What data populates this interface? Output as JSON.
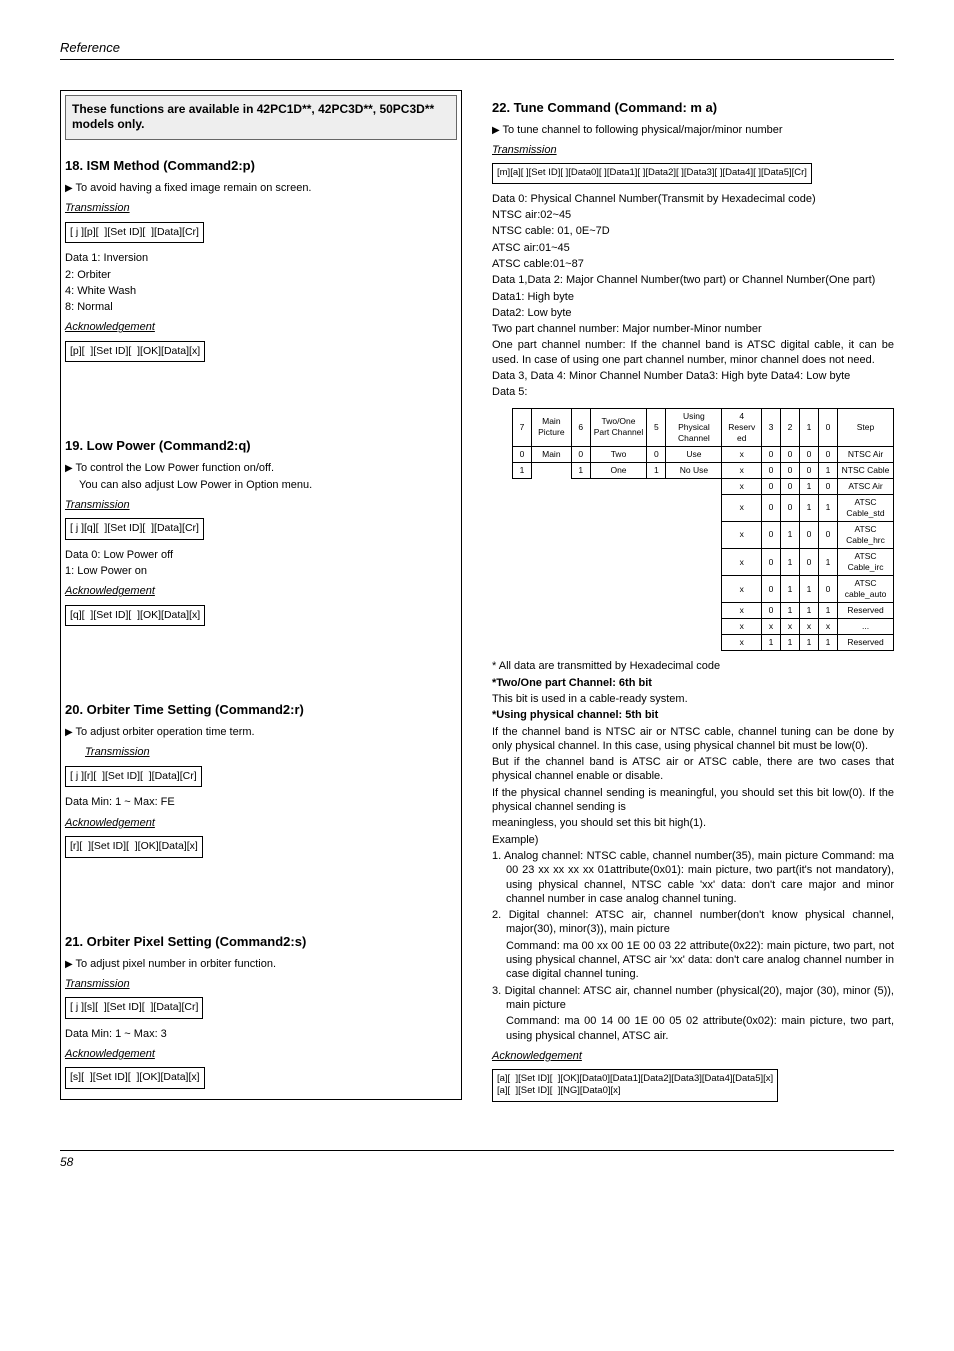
{
  "page": {
    "header": "Reference",
    "footer": "58"
  },
  "left": {
    "callout": "These functions are available in 42PC1D**, 42PC3D**,  50PC3D** models only.",
    "s18": {
      "title": "18. ISM Method (Command2:p)",
      "desc": "To avoid having a fixed image remain on screen.",
      "trans_h": "Transmission",
      "trans_box": "[ j ][p][  ][Set ID][  ][Data][Cr]",
      "data_h": "Data  1: Inversion",
      "d2": "2: Orbiter",
      "d3": "4: White Wash",
      "d4": "8: Normal",
      "ack_h": "Acknowledgement",
      "ack_box": "[p][  ][Set ID][  ][OK][Data][x]"
    },
    "s19": {
      "title": "19. Low Power (Command2:q)",
      "desc1": "To control the Low Power function on/off.",
      "desc2": "You can also adjust Low Power in Option menu.",
      "trans_h": "Transmission",
      "trans_box": "[ j ][q][  ][Set ID][  ][Data][Cr]",
      "data1": "Data  0: Low Power off",
      "data2": "1: Low Power on",
      "ack_h": "Acknowledgement",
      "ack_box": "[q][  ][Set ID][  ][OK][Data][x]"
    },
    "s20": {
      "title": "20. Orbiter Time Setting (Command2:r)",
      "desc": "To adjust orbiter operation time term.",
      "trans_h": "Transmission",
      "trans_box": "[ j ][r][  ][Set ID][  ][Data][Cr]",
      "data": "Data   Min: 1 ~ Max: FE",
      "ack_h": "Acknowledgement",
      "ack_box": "[r][  ][Set ID][  ][OK][Data][x]"
    },
    "s21": {
      "title": "21. Orbiter Pixel Setting (Command2:s)",
      "desc": "To adjust pixel number in orbiter function.",
      "trans_h": "Transmission",
      "trans_box": "[ j ][s][  ][Set ID][  ][Data][Cr]",
      "data": "Data   Min: 1 ~ Max: 3",
      "ack_h": "Acknowledgement",
      "ack_box": "[s][  ][Set ID][  ][OK][Data][x]"
    }
  },
  "right": {
    "s22": {
      "title": "22. Tune Command (Command: m a)",
      "desc": "To tune channel to following physical/major/minor number",
      "trans_h": "Transmission",
      "trans_box": "[m][a][ ][Set ID][ ][Data0][ ][Data1][ ][Data2][ ][Data3][ ][Data4][ ][Data5][Cr]",
      "data0": "Data  0: Physical Channel Number(Transmit by Hexadecimal code)",
      "d0_1": "NTSC air:02~45",
      "d0_2": "NTSC cable: 01, 0E~7D",
      "d0_3": "ATSC air:01~45",
      "d0_4": "ATSC cable:01~87",
      "data12": "Data 1,Data 2: Major Channel Number(two part) or Channel Number(One part)",
      "d12_1": "Data1: High byte",
      "d12_2": "Data2: Low byte",
      "d12_3": "Two part channel number: Major number-Minor number",
      "d12_4": "One part channel number: If the channel band is ATSC digital cable, it can be used. In case of using one part channel number, minor channel does not need.",
      "data34": "Data 3, Data 4: Minor Channel Number Data3: High byte Data4: Low byte",
      "data5": "Data 5:",
      "note_all": "* All data are transmitted by Hexadecimal code",
      "note_two_h": "*Two/One part Channel: 6th bit",
      "note_two": "This bit is used in a cable-ready system.",
      "note_phys_h": "*Using physical channel: 5th bit",
      "note_phys1": "If the channel band is NTSC air or NTSC cable, channel tuning can be done by only physical channel. In this case, using physical channel bit must be low(0).",
      "note_phys2": "But if the channel band is ATSC air or ATSC cable, there are two cases that physical channel enable or disable.",
      "note_phys3": "If the physical channel sending is meaningful, you should set this bit low(0). If the physical channel sending is",
      "note_phys4": "meaningless, you should set this bit high(1).",
      "example_h": "Example)",
      "ex1": "1. Analog channel: NTSC cable, channel number(35), main picture Command: ma 00 23 xx xx xx xx 01attribute(0x01): main picture, two part(it's not mandatory), using physical channel, NTSC cable 'xx' data: don't care major and minor channel number in case analog channel tuning.",
      "ex2": "2. Digital channel: ATSC air, channel number(don't know physical channel, major(30), minor(3)), main picture",
      "ex2b": "Command: ma 00 xx 00 1E 00 03 22 attribute(0x22): main picture, two part, not using physical channel, ATSC air 'xx' data: don't care analog channel number in case digital channel tuning.",
      "ex3": "3. Digital channel: ATSC air, channel number (physical(20), major (30), minor (5)), main picture",
      "ex3b": "Command: ma 00 14 00 1E 00 05 02 attribute(0x02): main picture, two part, using physical channel, ATSC air.",
      "ack_h": "Acknowledgement",
      "ack_box": "[a][  ][Set ID][  ][OK][Data0][Data1][Data2][Data3][Data4][Data5][x]\n[a][  ][Set ID][  ][NG][Data0][x]"
    },
    "table": {
      "rows": [
        [
          "7",
          "Main Picture",
          "6",
          "Two/One Part Channel",
          "5",
          "Using Physical Channel",
          "4 Reserv ed",
          "3",
          "2",
          "1",
          "0",
          "Step"
        ],
        [
          "0",
          "Main",
          "0",
          "Two",
          "0",
          "Use",
          "x",
          "0",
          "0",
          "0",
          "0",
          "NTSC Air"
        ],
        [
          "1",
          "",
          "1",
          "One",
          "1",
          "No Use",
          "x",
          "0",
          "0",
          "0",
          "1",
          "NTSC Cable"
        ],
        [
          "",
          "",
          "",
          "",
          "",
          "",
          "x",
          "0",
          "0",
          "1",
          "0",
          "ATSC Air"
        ],
        [
          "",
          "",
          "",
          "",
          "",
          "",
          "x",
          "0",
          "0",
          "1",
          "1",
          "ATSC Cable_std"
        ],
        [
          "",
          "",
          "",
          "",
          "",
          "",
          "x",
          "0",
          "1",
          "0",
          "0",
          "ATSC Cable_hrc"
        ],
        [
          "",
          "",
          "",
          "",
          "",
          "",
          "x",
          "0",
          "1",
          "0",
          "1",
          "ATSC Cable_irc"
        ],
        [
          "",
          "",
          "",
          "",
          "",
          "",
          "x",
          "0",
          "1",
          "1",
          "0",
          "ATSC cable_auto"
        ],
        [
          "",
          "",
          "",
          "",
          "",
          "",
          "x",
          "0",
          "1",
          "1",
          "1",
          "Reserved"
        ],
        [
          "",
          "",
          "",
          "",
          "",
          "",
          "x",
          "x",
          "x",
          "x",
          "x",
          "..."
        ],
        [
          "",
          "",
          "",
          "",
          "",
          "",
          "x",
          "1",
          "1",
          "1",
          "1",
          "Reserved"
        ]
      ]
    }
  }
}
